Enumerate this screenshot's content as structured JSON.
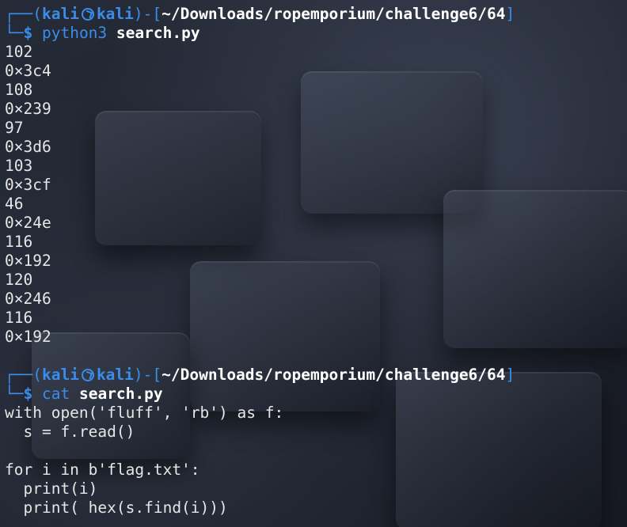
{
  "prompts": [
    {
      "top_prefix": "┌──(",
      "user": "kali",
      "host": "kali",
      "dir_open": ")-[",
      "cwd": "~/Downloads/ropemporium/challenge6/64",
      "dir_close": "]",
      "cmd_prefix": "└─",
      "dollar": "$",
      "command": "python3",
      "argument": "search.py"
    },
    {
      "top_prefix": "┌──(",
      "user": "kali",
      "host": "kali",
      "dir_open": ")-[",
      "cwd": "~/Downloads/ropemporium/challenge6/64",
      "dir_close": "]",
      "cmd_prefix": "└─",
      "dollar": "$",
      "command": "cat",
      "argument": "search.py"
    }
  ],
  "python_output": [
    "102",
    "0×3c4",
    "108",
    "0×239",
    "97",
    "0×3d6",
    "103",
    "0×3cf",
    "46",
    "0×24e",
    "116",
    "0×192",
    "120",
    "0×246",
    "116",
    "0×192"
  ],
  "script_source": [
    "with open('fluff', 'rb') as f:",
    "  s = f.read()",
    "",
    "for i in b'flag.txt':",
    "  print(i)",
    "  print( hex(s.find(i)))"
  ]
}
